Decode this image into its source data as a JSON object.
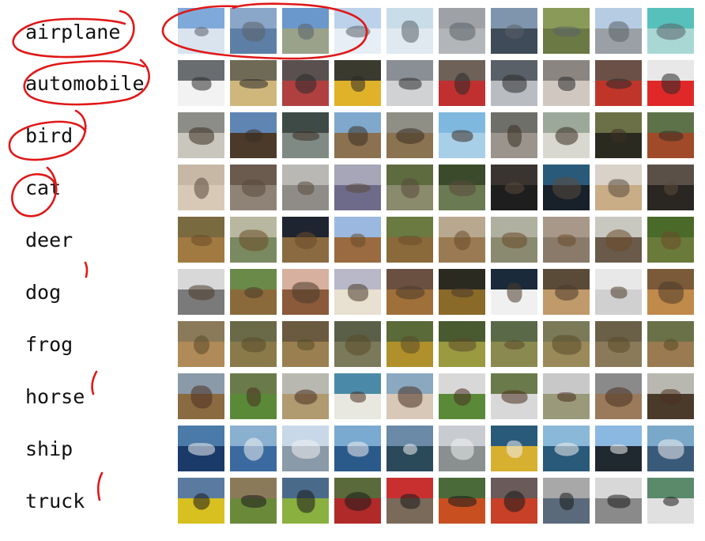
{
  "classes": [
    {
      "label": "airplane",
      "colors": [
        [
          "#7fa9d9",
          "#d9e4ef"
        ],
        [
          "#8aa6c8",
          "#5d7fa6"
        ],
        [
          "#6b98cc",
          "#9aa38a"
        ],
        [
          "#bcd2ea",
          "#e7eef5"
        ],
        [
          "#c9dde9",
          "#dfe9ef"
        ],
        [
          "#9ea2a6",
          "#b3b6b8"
        ],
        [
          "#7f95ad",
          "#3f4b58"
        ],
        [
          "#8a9a58",
          "#6b7a45"
        ],
        [
          "#b6cce3",
          "#9aa0a5"
        ],
        [
          "#57c0bb",
          "#a9d8d4"
        ]
      ],
      "subject": "#5a6068"
    },
    {
      "label": "automobile",
      "colors": [
        [
          "#6a6d70",
          "#f2f2f2"
        ],
        [
          "#6f6a55",
          "#cfb77b"
        ],
        [
          "#5a5050",
          "#b04040"
        ],
        [
          "#3a3a2e",
          "#e0b22a"
        ],
        [
          "#8a8f96",
          "#d0d2d4"
        ],
        [
          "#6e6258",
          "#c03030"
        ],
        [
          "#5a6068",
          "#b9bdc2"
        ],
        [
          "#8a8580",
          "#cfc7c0"
        ],
        [
          "#6b5048",
          "#c0352a"
        ],
        [
          "#e8e8e8",
          "#e02828"
        ]
      ],
      "subject": "#2a2a2a"
    },
    {
      "label": "bird",
      "colors": [
        [
          "#8c8c88",
          "#c9c6bd"
        ],
        [
          "#5f85b3",
          "#4b3a2a"
        ],
        [
          "#3e4a46",
          "#7f8a84"
        ],
        [
          "#7fa8cc",
          "#8c7150"
        ],
        [
          "#8f8f86",
          "#8a7350"
        ],
        [
          "#7fb8de",
          "#a8cfe8"
        ],
        [
          "#6f6f6a",
          "#9a948c"
        ],
        [
          "#9ba89a",
          "#d8d8d0"
        ],
        [
          "#6b7046",
          "#2a2a20"
        ],
        [
          "#5d7248",
          "#a04a2a"
        ]
      ],
      "subject": "#3a2e22"
    },
    {
      "label": "cat",
      "colors": [
        [
          "#c7b8a6",
          "#d8c9b7"
        ],
        [
          "#6b5a4e",
          "#8f8378"
        ],
        [
          "#b9b8b5",
          "#8f8c88"
        ],
        [
          "#a6a6b8",
          "#6e6a8a"
        ],
        [
          "#5d6b3e",
          "#8a8a6c"
        ],
        [
          "#3a4a2a",
          "#6a7a52"
        ],
        [
          "#3a3430",
          "#1e1e1e"
        ],
        [
          "#2a5a7a",
          "#18202a"
        ],
        [
          "#d8d2c8",
          "#c8ad86"
        ],
        [
          "#5a5048",
          "#2a2622"
        ]
      ],
      "subject": "#5a4a3c"
    },
    {
      "label": "deer",
      "colors": [
        [
          "#7a6a40",
          "#a07a40"
        ],
        [
          "#b8b8a0",
          "#7a8a60"
        ],
        [
          "#1e2430",
          "#8a6a40"
        ],
        [
          "#9ab8e0",
          "#9a6a40"
        ],
        [
          "#6a7a40",
          "#8a6a3a"
        ],
        [
          "#b8a890",
          "#9a7a52"
        ],
        [
          "#b0b0a0",
          "#8a8a70"
        ],
        [
          "#a8988a",
          "#8a7a6a"
        ],
        [
          "#c8c8c0",
          "#6a5a4a"
        ],
        [
          "#4a6a2a",
          "#6a7a3a"
        ]
      ],
      "subject": "#6a4a28"
    },
    {
      "label": "dog",
      "colors": [
        [
          "#d8d8d8",
          "#7a7a7a"
        ],
        [
          "#6a8a4a",
          "#8a6a3a"
        ],
        [
          "#d8b0a0",
          "#8a5a3a"
        ],
        [
          "#b8b8c8",
          "#e8e0d0"
        ],
        [
          "#6a5040",
          "#a0703a"
        ],
        [
          "#2a2a20",
          "#8a6a28"
        ],
        [
          "#1a2a3a",
          "#f0f0f0"
        ],
        [
          "#5a4a38",
          "#c09a6a"
        ],
        [
          "#e8e8e8",
          "#d0d0d0"
        ],
        [
          "#7a5a38",
          "#c08a4a"
        ]
      ],
      "subject": "#4a3a2a"
    },
    {
      "label": "frog",
      "colors": [
        [
          "#8a7a5a",
          "#b08a58"
        ],
        [
          "#6a6a48",
          "#8a7a4a"
        ],
        [
          "#6a5a40",
          "#9a8050"
        ],
        [
          "#5a6048",
          "#7a7a5a"
        ],
        [
          "#5a6a38",
          "#b0902a"
        ],
        [
          "#4a5a30",
          "#9a9a40"
        ],
        [
          "#5a6a48",
          "#8a8a50"
        ],
        [
          "#7a7a58",
          "#9a8a5a"
        ],
        [
          "#6a6048",
          "#8a7a5a"
        ],
        [
          "#6a7048",
          "#9a7a50"
        ]
      ],
      "subject": "#5a4a28"
    },
    {
      "label": "horse",
      "colors": [
        [
          "#8a9aa8",
          "#8a6a40"
        ],
        [
          "#6a7a4a",
          "#5a8a38"
        ],
        [
          "#b8b8b0",
          "#b09a70"
        ],
        [
          "#4a8aa8",
          "#e8e8e0"
        ],
        [
          "#8aa8c0",
          "#d8c8b8"
        ],
        [
          "#d8d8d8",
          "#5a8a38"
        ],
        [
          "#6a7a4a",
          "#d8d8d8"
        ],
        [
          "#c8c8c8",
          "#9a9a7a"
        ],
        [
          "#8a8a8a",
          "#9a7a5a"
        ],
        [
          "#b8b8b0",
          "#4a3a2a"
        ]
      ],
      "subject": "#4a3020"
    },
    {
      "label": "ship",
      "colors": [
        [
          "#4a7aa8",
          "#1a3a6a"
        ],
        [
          "#8ab0d0",
          "#3a6aa0"
        ],
        [
          "#c8d8e8",
          "#8a9aa8"
        ],
        [
          "#7aaad0",
          "#2a5a8a"
        ],
        [
          "#6a8aa8",
          "#2a4a5a"
        ],
        [
          "#c8ccd0",
          "#8a9090"
        ],
        [
          "#2a5a7a",
          "#d8b030"
        ],
        [
          "#8ab8d8",
          "#2a5a7a"
        ],
        [
          "#8ab8e0",
          "#202830"
        ],
        [
          "#7aa8c8",
          "#3a5a7a"
        ]
      ],
      "subject": "#f0f0f0"
    },
    {
      "label": "truck",
      "colors": [
        [
          "#5a7aa0",
          "#d8c020"
        ],
        [
          "#8a7a5a",
          "#6a8a3a"
        ],
        [
          "#4a6a8a",
          "#8ab040"
        ],
        [
          "#5a6a3a",
          "#b02a2a"
        ],
        [
          "#c83030",
          "#7a6a5a"
        ],
        [
          "#4a6a3a",
          "#c85020"
        ],
        [
          "#6a5a5a",
          "#c84028"
        ],
        [
          "#a8a8a8",
          "#5a6a7a"
        ],
        [
          "#d8d8d8",
          "#8a8a8a"
        ],
        [
          "#5a8a6a",
          "#e0e0e0"
        ]
      ],
      "subject": "#1a1a1a"
    }
  ]
}
